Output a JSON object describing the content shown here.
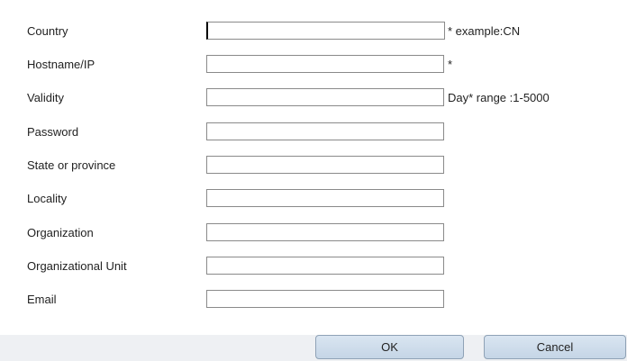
{
  "form": {
    "fields": [
      {
        "label": "Country",
        "value": "",
        "hint": "* example:CN"
      },
      {
        "label": "Hostname/IP",
        "value": "",
        "hint": "*"
      },
      {
        "label": "Validity",
        "value": "",
        "hint": "Day*  range :1-5000"
      },
      {
        "label": "Password",
        "value": "",
        "hint": ""
      },
      {
        "label": "State or province",
        "value": "",
        "hint": ""
      },
      {
        "label": "Locality",
        "value": "",
        "hint": ""
      },
      {
        "label": "Organization",
        "value": "",
        "hint": ""
      },
      {
        "label": "Organizational Unit",
        "value": "",
        "hint": ""
      },
      {
        "label": "Email",
        "value": "",
        "hint": ""
      }
    ]
  },
  "buttons": {
    "ok_label": "OK",
    "cancel_label": "Cancel"
  }
}
